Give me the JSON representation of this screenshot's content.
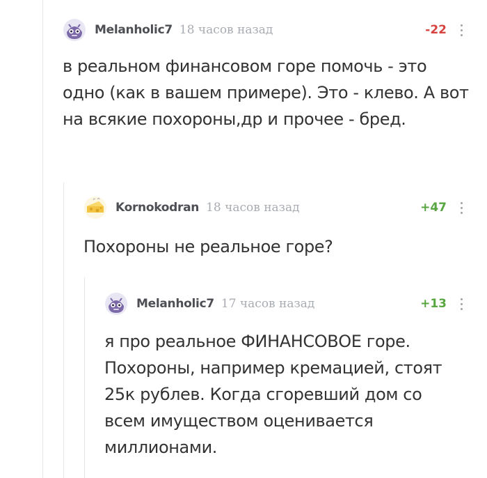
{
  "comments": [
    {
      "author": "Melanholic7",
      "time": "18 часов назад",
      "rating": "-22",
      "rating_color": "#d8433f",
      "avatar_icon": "purple-robot-avatar",
      "text": "в реальном финансовом горе помочь - это одно (как в вашем примере). Это - клево. А вот на всякие похороны,др и прочее - бред."
    },
    {
      "author": "Kornokodran",
      "time": "18 часов назад",
      "rating": "+47",
      "rating_color": "#57a640",
      "avatar_icon": "cheese-avatar",
      "text": "Похороны не реальное горе?"
    },
    {
      "author": "Melanholic7",
      "time": "17 часов назад",
      "rating": "+13",
      "rating_color": "#57a640",
      "avatar_icon": "purple-robot-avatar",
      "text": "я про реальное ФИНАНСОВОЕ горе. Похороны, например кремацией, стоят 25к рублев. Когда сгоревший дом со всем имуществом оценивается миллионами."
    }
  ],
  "more_icon": "more-vertical-icon",
  "thread_line_color": "#e4e6ea"
}
